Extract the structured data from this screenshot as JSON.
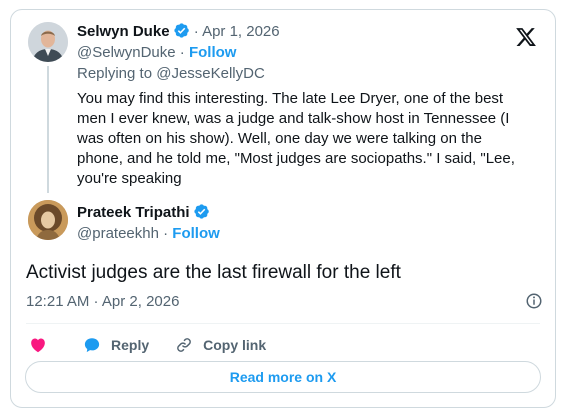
{
  "quoted": {
    "author_name": "Selwyn Duke",
    "dot": "·",
    "date": "Apr 1, 2026",
    "handle": "@SelwynDuke",
    "follow_label": "Follow",
    "replying_to": "Replying to @JesseKellyDC",
    "lines": [
      "You may find this interesting. The late Lee Dryer, one of the best",
      "men I ever knew, was a judge and talk-show host in Tennessee (I",
      "was often on his show). Well, one day we were talking on the",
      "phone, and he told me, \"Most judges are sociopaths.\" I said, \"Lee,",
      "you're speaking"
    ]
  },
  "tweet": {
    "author_name": "Prateek Tripathi",
    "handle": "@prateekhh",
    "dot": "·",
    "follow_label": "Follow",
    "text": "Activist judges are the last firewall for the left",
    "timestamp": "12:21 AM · Apr 2, 2026"
  },
  "actions": {
    "reply_label": "Reply",
    "copy_link_label": "Copy link"
  },
  "read_more_label": "Read more on X",
  "colors": {
    "accent": "#1d9bf0",
    "like": "#f91880",
    "muted": "#536471",
    "text": "#0f1419",
    "border": "#cfd9de"
  },
  "icons": [
    "x-logo-icon",
    "verified-badge-icon",
    "info-icon",
    "heart-icon",
    "reply-bubble-icon",
    "link-icon"
  ]
}
